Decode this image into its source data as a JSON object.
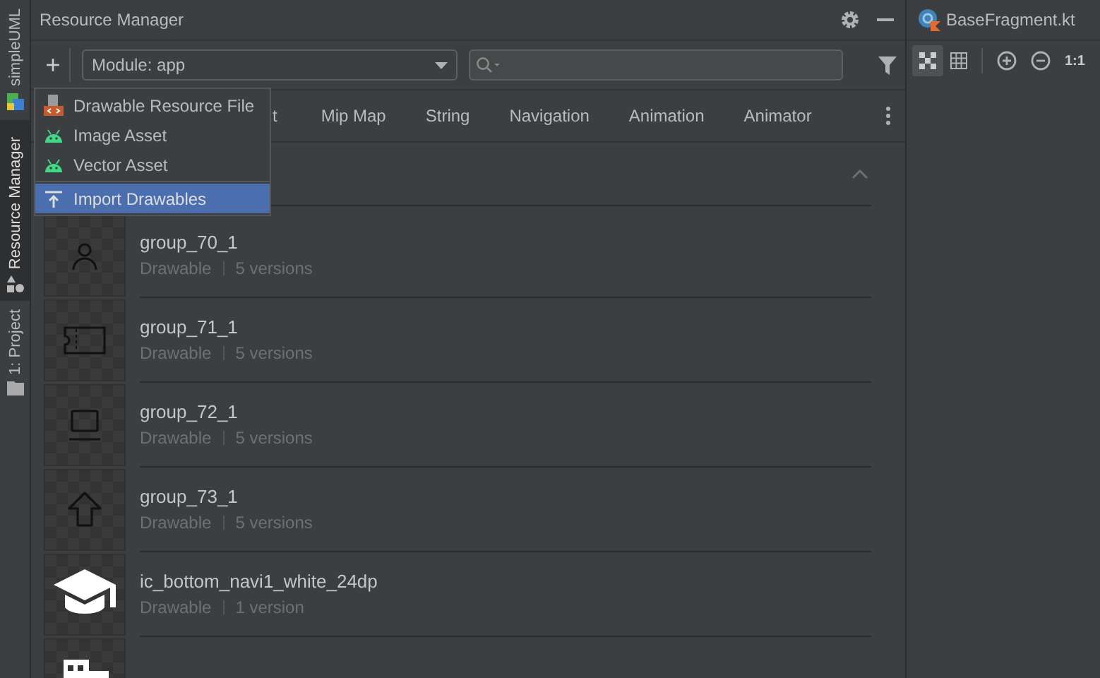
{
  "side_tabs": [
    {
      "label": "simpleUML",
      "selected": false
    },
    {
      "label": "Resource Manager",
      "selected": true
    },
    {
      "label": "1: Project",
      "selected": false
    }
  ],
  "panel": {
    "title": "Resource Manager"
  },
  "toolbar": {
    "add": "+",
    "module": "Module: app"
  },
  "tabs": [
    {
      "label": "t"
    },
    {
      "label": "Mip Map"
    },
    {
      "label": "String"
    },
    {
      "label": "Navigation"
    },
    {
      "label": "Animation"
    },
    {
      "label": "Animator"
    }
  ],
  "add_menu": [
    {
      "label": "Drawable Resource File",
      "kind": "file",
      "selected": false
    },
    {
      "label": "Image Asset",
      "kind": "android",
      "selected": false
    },
    {
      "label": "Vector Asset",
      "kind": "android",
      "selected": false
    },
    {
      "label": "Import Drawables",
      "kind": "import",
      "selected": true
    }
  ],
  "resources": [
    {
      "name": "group_70_1",
      "type": "Drawable",
      "versions": "5 versions",
      "kind": "person"
    },
    {
      "name": "group_71_1",
      "type": "Drawable",
      "versions": "5 versions",
      "kind": "ticket"
    },
    {
      "name": "group_72_1",
      "type": "Drawable",
      "versions": "5 versions",
      "kind": "laptop"
    },
    {
      "name": "group_73_1",
      "type": "Drawable",
      "versions": "5 versions",
      "kind": "upload"
    },
    {
      "name": "ic_bottom_navi1_white_24dp",
      "type": "Drawable",
      "versions": "1 version",
      "kind": "cap"
    },
    {
      "kind": "building"
    }
  ],
  "editor": {
    "tab": "BaseFragment.kt",
    "zoom_reset": "1:1"
  }
}
